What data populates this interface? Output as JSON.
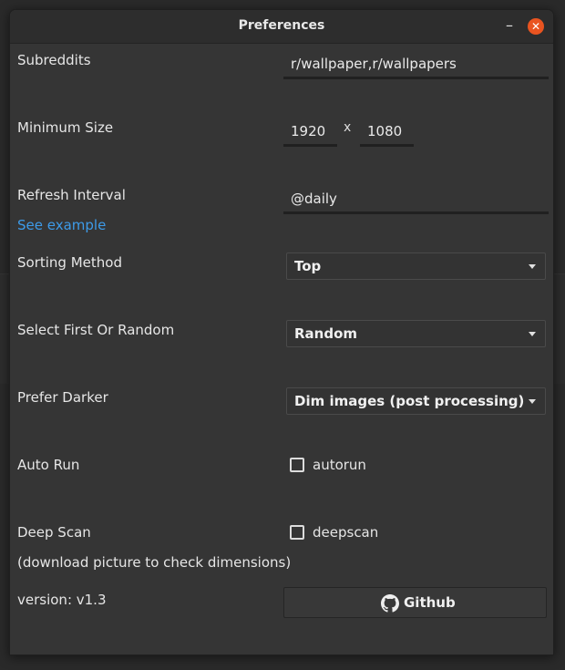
{
  "window": {
    "title": "Preferences",
    "minimize_glyph": "–",
    "close_glyph": "✕"
  },
  "subreddits": {
    "label": "Subreddits",
    "value": "r/wallpaper,r/wallpapers"
  },
  "minimum_size": {
    "label": "Minimum Size",
    "width": "1920",
    "separator": "x",
    "height": "1080"
  },
  "refresh_interval": {
    "label": "Refresh Interval",
    "link": "See example",
    "value": "@daily"
  },
  "sorting_method": {
    "label": "Sorting Method",
    "selected": "Top"
  },
  "select_first_or_random": {
    "label": "Select First Or Random",
    "selected": "Random"
  },
  "prefer_darker": {
    "label": "Prefer Darker",
    "selected": "Dim images (post processing)"
  },
  "auto_run": {
    "label": "Auto Run",
    "checkbox_label": "autorun",
    "checked": false
  },
  "deep_scan": {
    "label": "Deep Scan",
    "note": "(download picture to check dimensions)",
    "checkbox_label": "deepscan",
    "checked": false
  },
  "footer": {
    "version": "version: v1.3",
    "github_button": "Github",
    "github_icon": "github-icon"
  },
  "colors": {
    "accent_link": "#3d9be9",
    "close_button": "#e95420",
    "window_bg": "#353535"
  }
}
